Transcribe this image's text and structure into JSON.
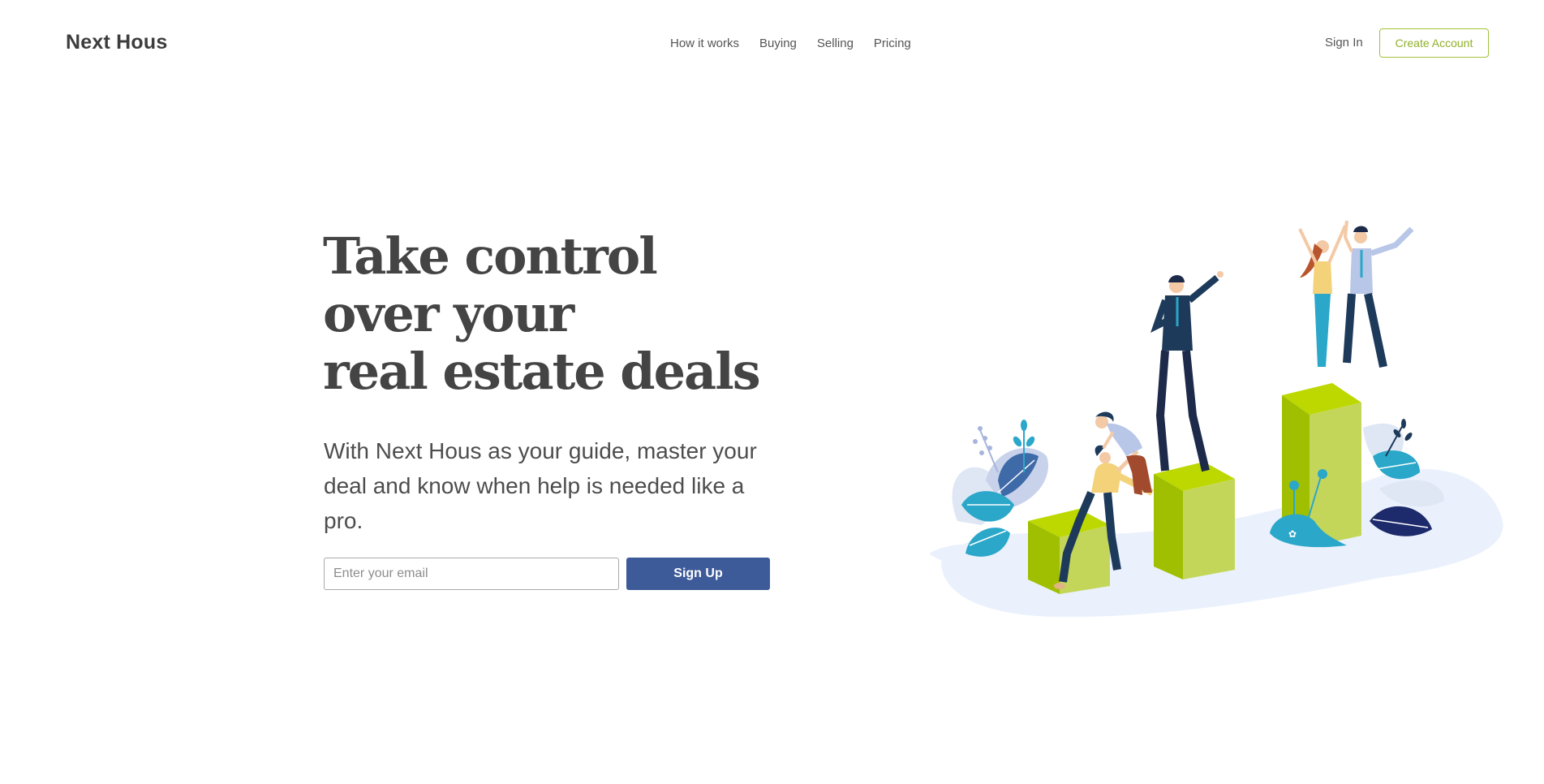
{
  "header": {
    "logo": "Next Hous",
    "nav": [
      "How it works",
      "Buying",
      "Selling",
      "Pricing"
    ],
    "sign_in": "Sign In",
    "create_account": "Create Account"
  },
  "hero": {
    "headline": [
      "Take control",
      "over your",
      "real estate deals"
    ],
    "subtext": "With Next Hous as your guide, master your deal and know when help is needed like a pro.",
    "email_placeholder": "Enter your email",
    "signup_label": "Sign Up"
  },
  "colors": {
    "accent_green": "#a2c13a",
    "button_blue": "#3d5a99",
    "text_dark": "#444444"
  },
  "illustration": {
    "icon": "team-celebrating-on-podiums-illustration"
  }
}
